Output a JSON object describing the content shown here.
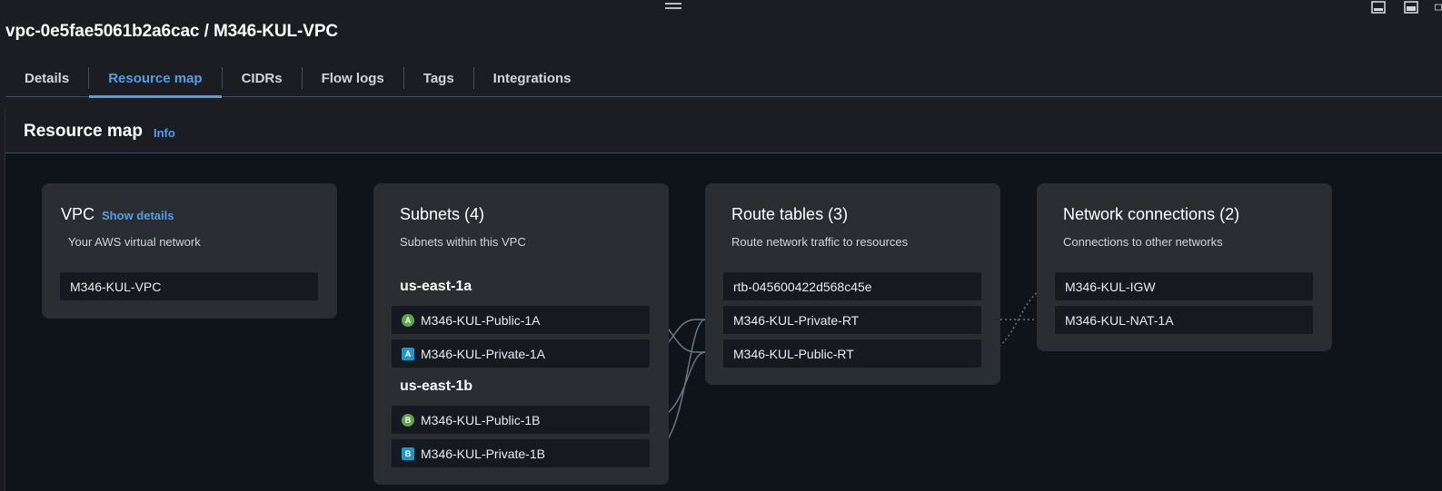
{
  "page": {
    "title": "vpc-0e5fae5061b2a6cac / M346-KUL-VPC"
  },
  "tabs": [
    {
      "label": "Details",
      "active": false
    },
    {
      "label": "Resource map",
      "active": true
    },
    {
      "label": "CIDRs",
      "active": false
    },
    {
      "label": "Flow logs",
      "active": false
    },
    {
      "label": "Tags",
      "active": false
    },
    {
      "label": "Integrations",
      "active": false
    }
  ],
  "panel": {
    "title": "Resource map",
    "info_label": "Info"
  },
  "vpc_card": {
    "title": "VPC",
    "show_details": "Show details",
    "subtitle": "Your AWS virtual network",
    "item": "M346-KUL-VPC"
  },
  "subnets_card": {
    "title": "Subnets (4)",
    "subtitle": "Subnets within this VPC",
    "zones": [
      {
        "name": "us-east-1a",
        "items": [
          {
            "label": "M346-KUL-Public-1A",
            "badge": "A",
            "badge_shape": "circle",
            "badge_color": "#5fa54a"
          },
          {
            "label": "M346-KUL-Private-1A",
            "badge": "A",
            "badge_shape": "square",
            "badge_color": "#1d99c7"
          }
        ]
      },
      {
        "name": "us-east-1b",
        "items": [
          {
            "label": "M346-KUL-Public-1B",
            "badge": "B",
            "badge_shape": "circle",
            "badge_color": "#5fa54a"
          },
          {
            "label": "M346-KUL-Private-1B",
            "badge": "B",
            "badge_shape": "square",
            "badge_color": "#1d99c7"
          }
        ]
      }
    ]
  },
  "route_tables_card": {
    "title": "Route tables (3)",
    "subtitle": "Route network traffic to resources",
    "items": [
      "rtb-045600422d568c45e",
      "M346-KUL-Private-RT",
      "M346-KUL-Public-RT"
    ]
  },
  "network_card": {
    "title": "Network connections (2)",
    "subtitle": "Connections to other networks",
    "items": [
      "M346-KUL-IGW",
      "M346-KUL-NAT-1A"
    ]
  },
  "colors": {
    "accent": "#539fe5",
    "public_badge": "#5fa54a",
    "private_badge": "#1d99c7",
    "connector": "#6b7580"
  }
}
